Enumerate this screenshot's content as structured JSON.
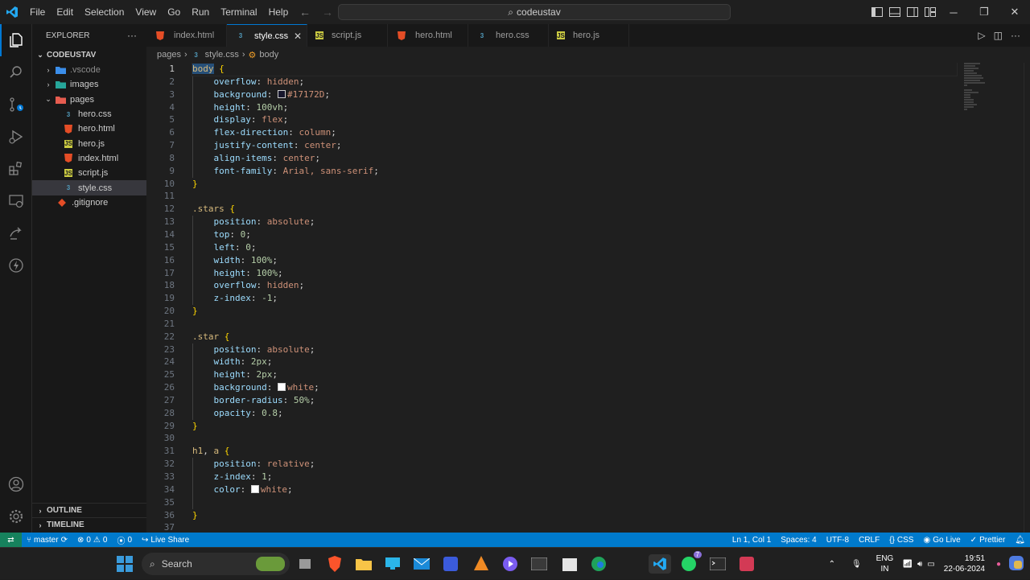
{
  "titlebar": {
    "menu": [
      "File",
      "Edit",
      "Selection",
      "View",
      "Go",
      "Run",
      "Terminal",
      "Help"
    ],
    "command_center": "codeustav"
  },
  "sidebar": {
    "header": "EXPLORER",
    "more": "···",
    "folder": "CODEUSTAV",
    "items": [
      {
        "label": ".vscode",
        "type": "folder"
      },
      {
        "label": "images",
        "type": "folder"
      },
      {
        "label": "pages",
        "type": "folder-open"
      },
      {
        "label": "hero.css",
        "type": "css"
      },
      {
        "label": "hero.html",
        "type": "html"
      },
      {
        "label": "hero.js",
        "type": "js"
      },
      {
        "label": "index.html",
        "type": "html"
      },
      {
        "label": "script.js",
        "type": "js"
      },
      {
        "label": "style.css",
        "type": "css"
      },
      {
        "label": ".gitignore",
        "type": "git"
      }
    ],
    "outline": "OUTLINE",
    "timeline": "TIMELINE"
  },
  "tabs": [
    {
      "label": "index.html",
      "type": "html"
    },
    {
      "label": "style.css",
      "type": "css",
      "active": true
    },
    {
      "label": "script.js",
      "type": "js"
    },
    {
      "label": "hero.html",
      "type": "html"
    },
    {
      "label": "hero.css",
      "type": "css"
    },
    {
      "label": "hero.js",
      "type": "js"
    }
  ],
  "breadcrumb": {
    "folder": "pages",
    "file": "style.css",
    "symbol": "body"
  },
  "editor": {
    "current_line": 1,
    "line_count": 37
  },
  "statusbar": {
    "branch": "master",
    "errors": "0",
    "warnings": "0",
    "ports": "0",
    "live_share": "Live Share",
    "position": "Ln 1, Col 1",
    "spaces": "Spaces: 4",
    "encoding": "UTF-8",
    "eol": "CRLF",
    "language": "CSS",
    "go_live": "Go Live",
    "prettier": "Prettier"
  },
  "taskbar": {
    "search": "Search",
    "lang_top": "ENG",
    "lang_bottom": "IN",
    "time": "19:51",
    "date": "22-06-2024",
    "whatsapp_badge": "7"
  },
  "colors": {
    "accent": "#007acc",
    "css_icon": "#519aba",
    "html_icon": "#e44d26",
    "js_icon": "#cbcb41"
  }
}
